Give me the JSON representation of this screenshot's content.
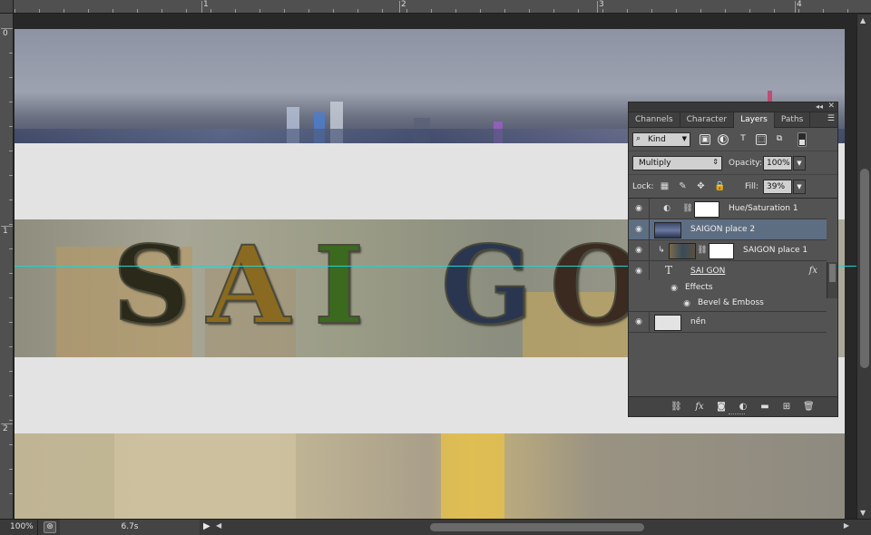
{
  "rulers": {
    "top_labels": [
      "1",
      "2",
      "3",
      "4"
    ],
    "left_labels": [
      "0",
      "1",
      "2"
    ]
  },
  "canvas": {
    "title_text": "SAI GON",
    "letters": [
      "S",
      "A",
      "I",
      "G",
      "O"
    ],
    "colors": {
      "band": "#e3e3e3",
      "guide": "#1fd3d3",
      "letter_fill": "#2b2a1a"
    }
  },
  "status_bar": {
    "zoom": "100%",
    "doc_info": "6.7s",
    "play_icon": "play-icon"
  },
  "layers_panel": {
    "tabs": [
      "Channels",
      "Character",
      "Layers",
      "Paths"
    ],
    "active_tab": "Layers",
    "filter": {
      "kind_label": "Kind"
    },
    "blend": {
      "mode": "Multiply",
      "opacity_label": "Opacity:",
      "opacity": "100%",
      "fill_label": "Fill:",
      "fill": "39%"
    },
    "lock_label": "Lock:",
    "layers": [
      {
        "name": "Hue/Saturation 1",
        "type": "adjustment",
        "selected": false
      },
      {
        "name": "SAIGON place 2",
        "type": "image",
        "selected": true
      },
      {
        "name": "SAIGON place 1",
        "type": "image-clipped",
        "selected": false
      },
      {
        "name": "SAI GON",
        "type": "text",
        "selected": false,
        "fx": "fx"
      },
      {
        "name": "nền",
        "type": "fill",
        "selected": false
      }
    ],
    "effects": {
      "header": "Effects",
      "items": [
        "Bevel & Emboss"
      ]
    },
    "colors": {
      "selected_row": "#5e6e82",
      "panel_bg": "#535353"
    }
  }
}
